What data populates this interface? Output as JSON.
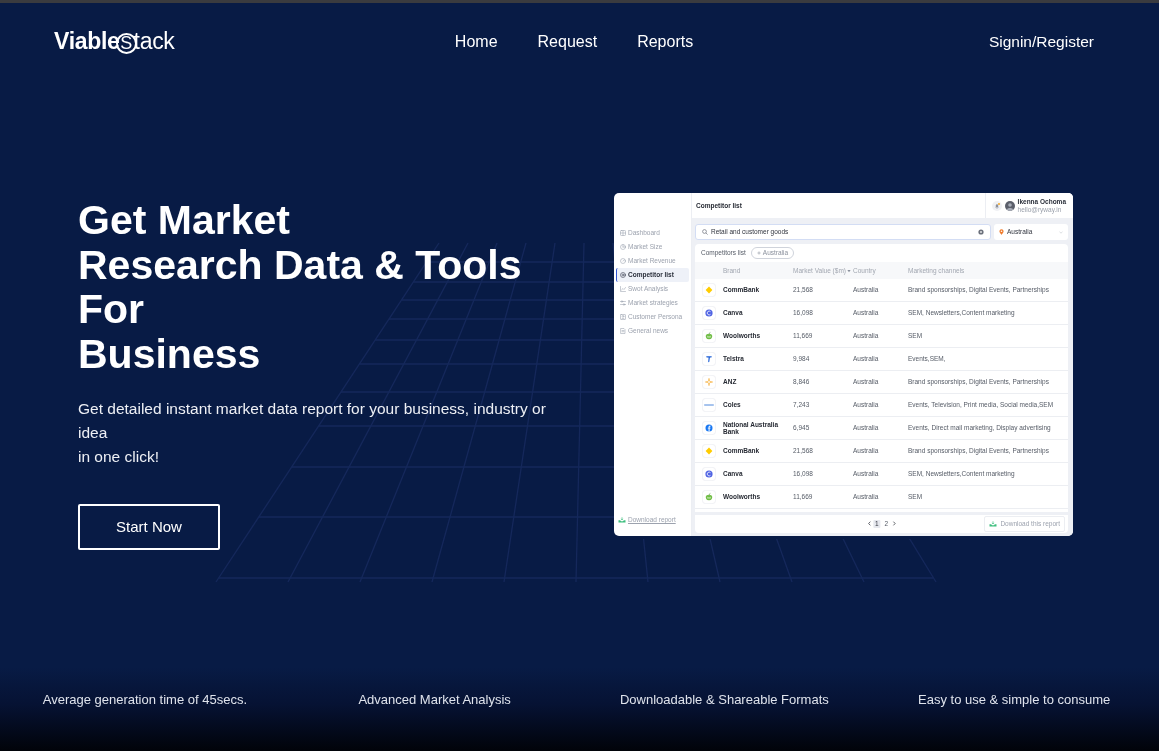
{
  "nav": {
    "logo": {
      "bold": "Viable",
      "light": "Stack"
    },
    "links": [
      "Home",
      "Request",
      "Reports"
    ],
    "account_link": "Signin/Register"
  },
  "hero": {
    "title_lines": [
      "Get Market",
      "Research Data & Tools For",
      "Business"
    ],
    "description_lines": [
      "Get detailed instant market data report for your business, industry or idea",
      "in one click!"
    ],
    "button": "Start Now"
  },
  "app_preview": {
    "sidebar": {
      "items": [
        {
          "label": "Dashboard",
          "selected": false
        },
        {
          "label": "Market Size",
          "selected": false
        },
        {
          "label": "Market Revenue",
          "selected": false
        },
        {
          "label": "Competitor list",
          "selected": true
        },
        {
          "label": "Swot Analysis",
          "selected": false
        },
        {
          "label": "Market strategies",
          "selected": false
        },
        {
          "label": "Customer Persona",
          "selected": false
        },
        {
          "label": "General news",
          "selected": false
        }
      ],
      "download_link": "Download report"
    },
    "header": {
      "title": "Competitor list",
      "user_name": "Ikenna Ochoma",
      "user_email": "hello@ryway.in"
    },
    "search": {
      "value": "Retail and customer goods"
    },
    "location": {
      "value": "Australia"
    },
    "list": {
      "title": "Competitors list",
      "filter_chip": "Australia",
      "columns": [
        "Brand",
        "Market Value ($m)",
        "Country",
        "Marketing channels"
      ],
      "rows": [
        {
          "kind": "diamond",
          "brand": "CommBank",
          "value": "21,568",
          "country": "Australia",
          "channels": "Brand sponsorships, Digital Events, Partnerships"
        },
        {
          "kind": "swirl",
          "brand": "Canva",
          "value": "16,098",
          "country": "Australia",
          "channels": "SEM, Newsletters,Content marketing"
        },
        {
          "kind": "apple",
          "brand": "Woolworths",
          "value": "11,669",
          "country": "Australia",
          "channels": "SEM"
        },
        {
          "kind": "tee",
          "brand": "Telstra",
          "value": "9,984",
          "country": "Australia",
          "channels": "Events,SEM,"
        },
        {
          "kind": "star",
          "brand": "ANZ",
          "value": "8,846",
          "country": "Australia",
          "channels": "Brand sponsorships, Digital Events, Partnerships"
        },
        {
          "kind": "dash",
          "brand": "Coles",
          "value": "7,243",
          "country": "Australia",
          "channels": "Events, Television, Print media, Social media,SEM"
        },
        {
          "kind": "disc",
          "brand": "National Australia Bank",
          "value": "6,945",
          "country": "Australia",
          "channels": "Events, Direct mail marketing, Display advertising"
        },
        {
          "kind": "diamond",
          "brand": "CommBank",
          "value": "21,568",
          "country": "Australia",
          "channels": "Brand sponsorships, Digital Events, Partnerships"
        },
        {
          "kind": "swirl",
          "brand": "Canva",
          "value": "16,098",
          "country": "Australia",
          "channels": "SEM, Newsletters,Content marketing"
        },
        {
          "kind": "apple",
          "brand": "Woolworths",
          "value": "11,669",
          "country": "Australia",
          "channels": "SEM"
        }
      ]
    },
    "pagination": {
      "pages": [
        {
          "label": "1",
          "selected": true
        },
        {
          "label": "2",
          "selected": false
        }
      ]
    },
    "download_button": "Download this report"
  },
  "features": [
    "Average generation time of 45secs.",
    "Advanced Market Analysis",
    "Downloadable & Shareable Formats",
    "Easy to use & simple to consume"
  ]
}
